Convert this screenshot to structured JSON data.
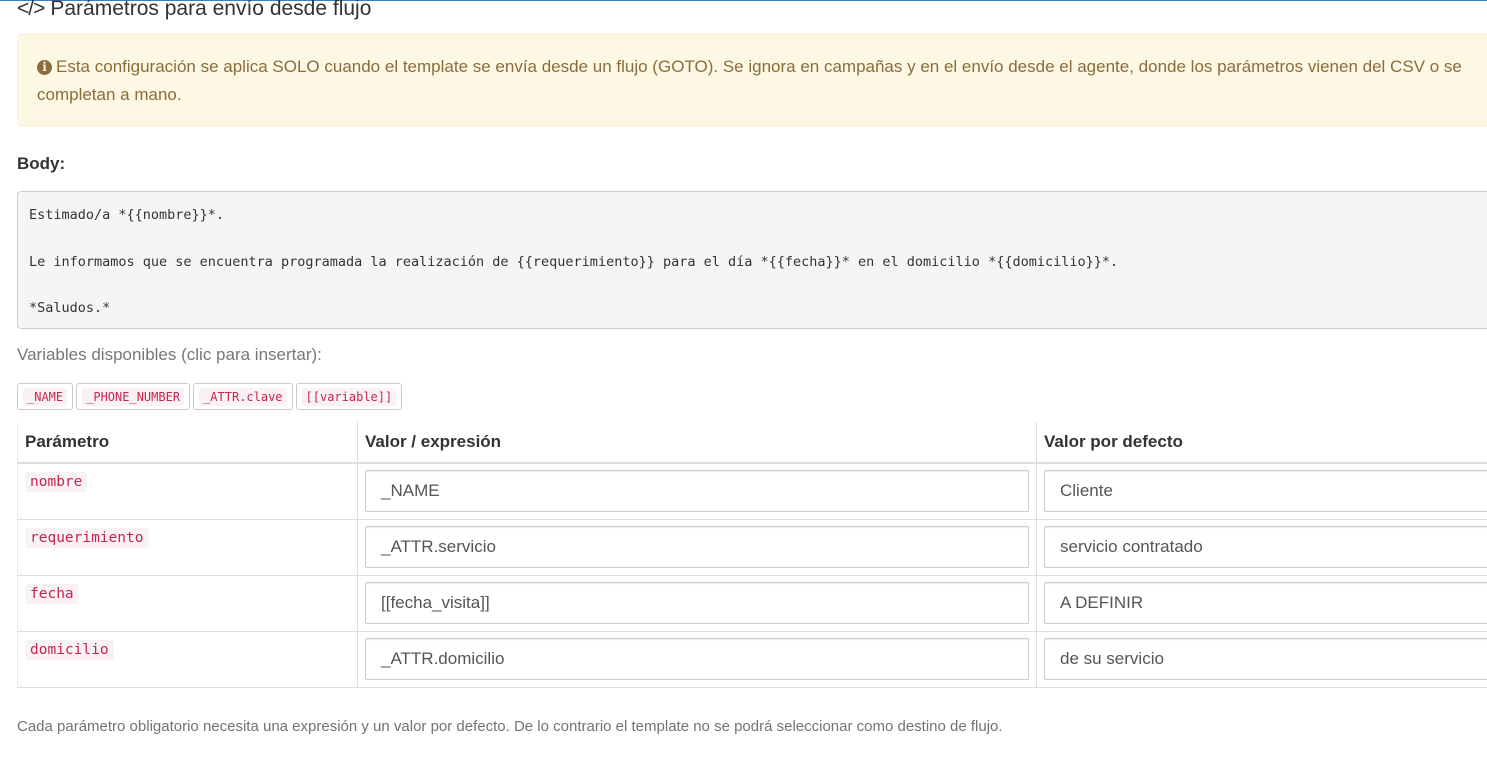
{
  "section": {
    "icon": "code-icon",
    "title": "Parámetros para envío desde flujo"
  },
  "alert": {
    "icon": "info-circle-icon",
    "text": "Esta configuración se aplica SOLO cuando el template se envía desde un flujo (GOTO). Se ignora en campañas y en el envío desde el agente, donde los parámetros vienen del CSV o se completan a mano.",
    "background": "#fcf8e3",
    "color": "#8a6d3b"
  },
  "body": {
    "label": "Body:",
    "content": "Estimado/a *{{nombre}}*.\n\nLe informamos que se encuentra programada la realización de {{requerimiento}} para el día *{{fecha}}* en el domicilio *{{domicilio}}*.\n\n*Saludos.*"
  },
  "variables": {
    "label": "Variables disponibles (clic para insertar):",
    "chips": [
      "_NAME",
      "_PHONE_NUMBER",
      "_ATTR.clave",
      "[[variable]]"
    ]
  },
  "table": {
    "headers": {
      "param": "Parámetro",
      "value": "Valor / expresión",
      "default": "Valor por defecto"
    },
    "rows": [
      {
        "param": "nombre",
        "value": "_NAME",
        "default": "Cliente"
      },
      {
        "param": "requerimiento",
        "value": "_ATTR.servicio",
        "default": "servicio contratado"
      },
      {
        "param": "fecha",
        "value": "[[fecha_visita]]",
        "default": "A DEFINIR"
      },
      {
        "param": "domicilio",
        "value": "_ATTR.domicilio",
        "default": "de su servicio"
      }
    ]
  },
  "help": {
    "text": "Cada parámetro obligatorio necesita una expresión y un valor por defecto. De lo contrario el template no se podrá seleccionar como destino de flujo."
  },
  "colors": {
    "code_text": "#c7254e",
    "code_bg": "#f9f2f4",
    "top_rule": "#3a7fbf"
  }
}
